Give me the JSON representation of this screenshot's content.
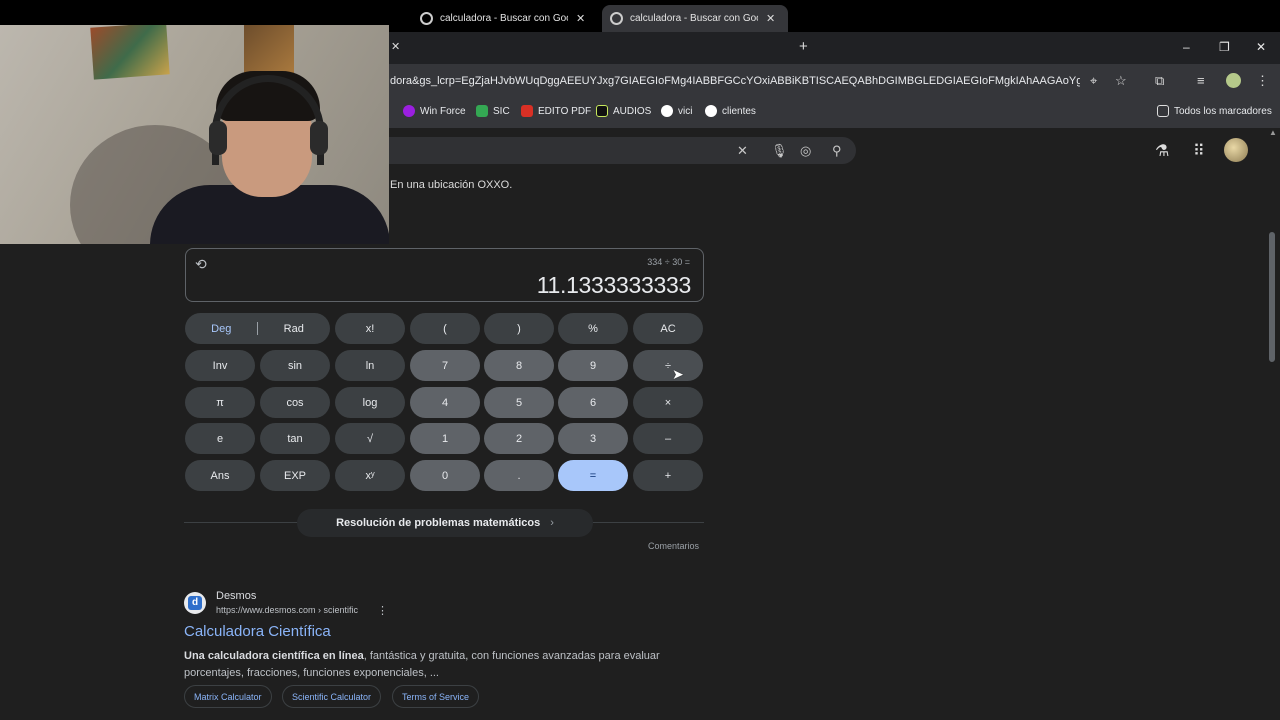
{
  "browser": {
    "tabs": [
      {
        "title": "calculadora - Buscar con Google",
        "active": false
      },
      {
        "title": "calculadora - Buscar con Google",
        "active": true
      }
    ],
    "new_tab_label": "+",
    "window_controls": {
      "minimize": "–",
      "restore": "❐",
      "close": "✕"
    },
    "url": "dora&gs_lcrp=EgZjaHJvbWUqDggAEEUYJxg7GIAEGIoFMg4IABBFGCcYOxiABBiKBTISCAEQABhDGIMBGLEDGIAEGIoFMgkIAhAAGAoYgAQy...",
    "bookmarks": [
      {
        "label": "Win Force",
        "color": "#9b1fe0"
      },
      {
        "label": "SIC",
        "color": "#34a853"
      },
      {
        "label": "EDITO PDF",
        "color": "#d93025"
      },
      {
        "label": "AUDIOS",
        "color": "#111111"
      },
      {
        "label": "vici",
        "color": "#ffffff"
      },
      {
        "label": "clientes",
        "color": "#ffffff"
      }
    ],
    "all_bookmarks": "Todos los marcadores"
  },
  "search": {
    "clear_icon": "✕",
    "snippet_above": "En una ubicación OXXO."
  },
  "calculator": {
    "expression": "334 ÷ 30 =",
    "result": "11.1333333333",
    "mode": {
      "deg": "Deg",
      "rad": "Rad"
    },
    "keys": [
      [
        "x!",
        "(",
        ")",
        "%",
        "AC"
      ],
      [
        "Inv",
        "sin",
        "ln",
        "7",
        "8",
        "9",
        "÷"
      ],
      [
        "π",
        "cos",
        "log",
        "4",
        "5",
        "6",
        "×"
      ],
      [
        "e",
        "tan",
        "√",
        "1",
        "2",
        "3",
        "–"
      ],
      [
        "Ans",
        "EXP",
        "xʸ",
        "0",
        ".",
        "=",
        "+"
      ]
    ]
  },
  "math_solver": "Resolución de problemas matemáticos",
  "feedback": "Comentarios",
  "result_item": {
    "site": "Desmos",
    "url": "https://www.desmos.com › scientific",
    "title": "Calculadora Científica",
    "snippet_bold": "Una calculadora científica en línea",
    "snippet_rest": ", fantástica y gratuita, con funciones avanzadas para evaluar porcentajes, fracciones, funciones exponenciales, ...",
    "chips": [
      "Matrix Calculator",
      "Scientific Calculator",
      "Terms of Service"
    ]
  },
  "colors": {
    "page_bg": "#1f1f1f",
    "equals_key": "#a8c7fa",
    "link": "#8ab4f8"
  }
}
